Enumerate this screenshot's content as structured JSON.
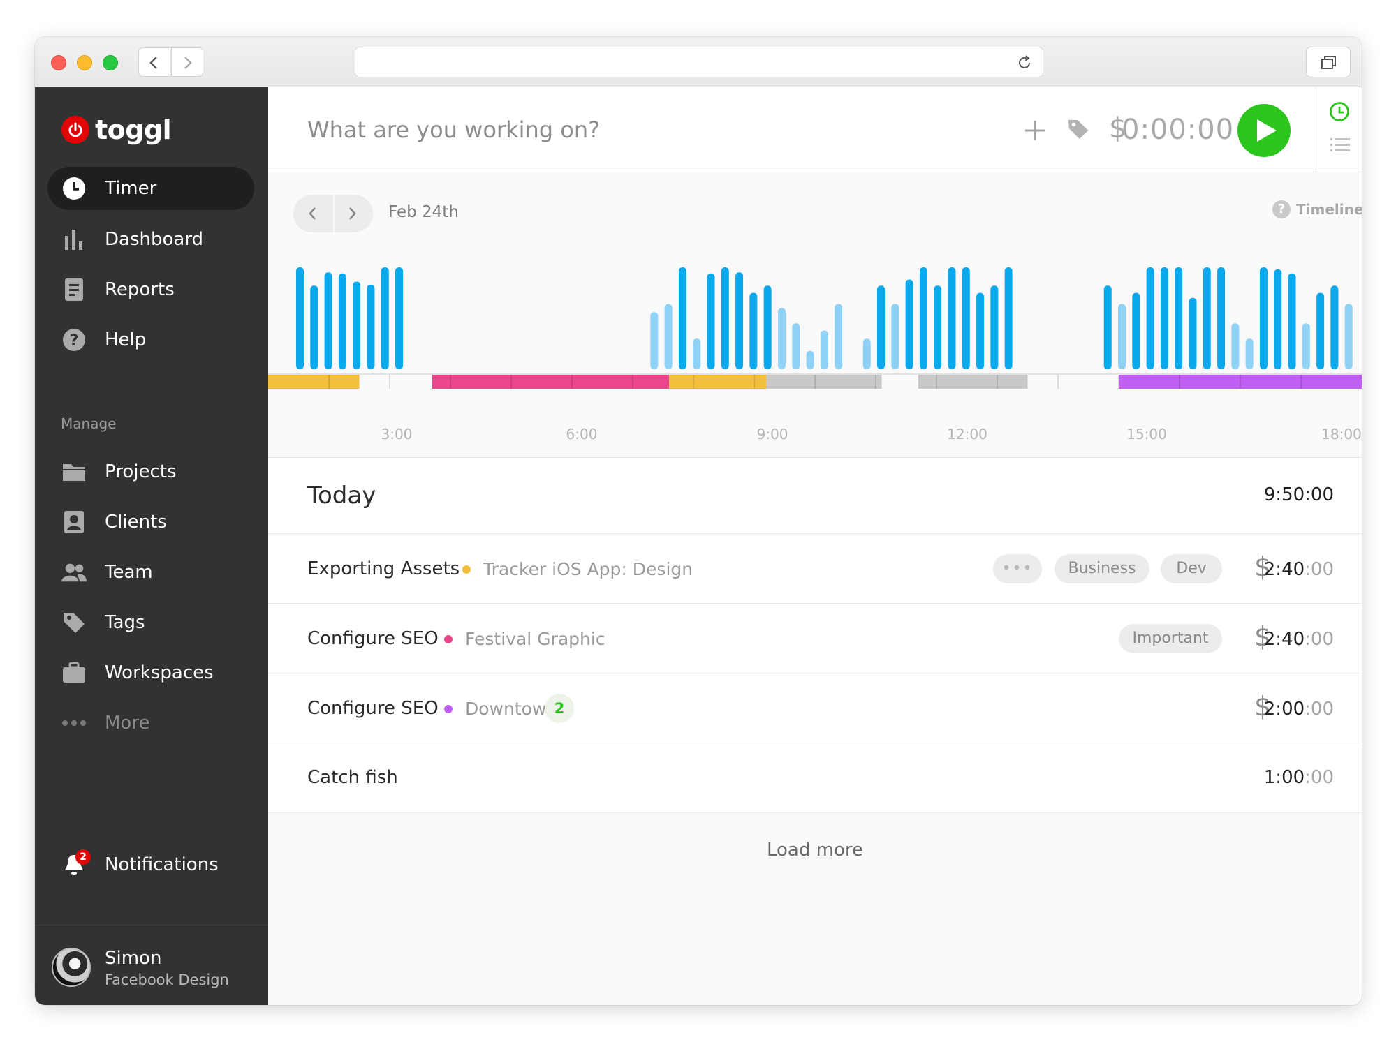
{
  "sidebar": {
    "brand": "toggl",
    "items": [
      {
        "label": "Timer"
      },
      {
        "label": "Dashboard"
      },
      {
        "label": "Reports"
      },
      {
        "label": "Help"
      }
    ],
    "section_label": "Manage",
    "manage_items": [
      {
        "label": "Projects"
      },
      {
        "label": "Clients"
      },
      {
        "label": "Team"
      },
      {
        "label": "Tags"
      },
      {
        "label": "Workspaces"
      },
      {
        "label": "More"
      }
    ],
    "notifications": {
      "label": "Notifications",
      "count": "2"
    },
    "user": {
      "name": "Simon",
      "workspace": "Facebook Design"
    }
  },
  "timer": {
    "placeholder": "What are you working on?",
    "elapsed": "0:00:00"
  },
  "timeline": {
    "date": "Feb 24th",
    "mode": "Timeline",
    "tick_labels": [
      "3:00",
      "6:00",
      "9:00",
      "12:00",
      "15:00",
      "18:00"
    ]
  },
  "chart_data": {
    "type": "bar",
    "description_unit": "activity level per time slot",
    "values": [
      1.0,
      0.82,
      0.95,
      0.94,
      0.86,
      0.83,
      1.0,
      1.0,
      null,
      null,
      null,
      null,
      null,
      null,
      null,
      null,
      null,
      null,
      null,
      null,
      null,
      null,
      null,
      null,
      null,
      0.56,
      0.64,
      1.0,
      0.3,
      0.94,
      1.0,
      0.95,
      0.75,
      0.82,
      0.6,
      0.45,
      0.18,
      0.38,
      0.64,
      null,
      0.3,
      0.82,
      0.64,
      0.88,
      1.0,
      0.82,
      1.0,
      1.0,
      0.75,
      0.82,
      1.0,
      null,
      null,
      null,
      null,
      null,
      null,
      0.82,
      0.64,
      0.75,
      1.0,
      1.0,
      1.0,
      0.7,
      1.0,
      1.0,
      0.45,
      0.3,
      1.0,
      0.98,
      0.94,
      0.45,
      0.75,
      0.82,
      0.64
    ],
    "tracked_segments": [
      {
        "from": 0.0,
        "to": 1.5,
        "color": "#f2bf3c"
      },
      {
        "from": 2.7,
        "to": 6.6,
        "color": "#e9468b"
      },
      {
        "from": 6.6,
        "to": 8.2,
        "color": "#f2bf3c"
      },
      {
        "from": 8.2,
        "to": 10.1,
        "color": "#c9c9c9"
      },
      {
        "from": 10.7,
        "to": 12.5,
        "color": "#c9c9c9"
      },
      {
        "from": 14.0,
        "to": 18.0,
        "color": "#c15ff0"
      }
    ],
    "bar_colors": {
      "strong": "#0aa8ec",
      "light": "#8fd2f5"
    }
  },
  "today": {
    "title": "Today",
    "total": "9:50:00",
    "entries": [
      {
        "description": "Exporting Assets",
        "project": "Tracker iOS App: Design",
        "project_color": "#f2bf3c",
        "tags": [
          "Business",
          "Dev"
        ],
        "more_tags": "•••",
        "billable": "$",
        "duration_main": "2:40",
        "duration_secs": ":00"
      },
      {
        "description": "Configure SEO",
        "project": "Festival Graphic",
        "project_color": "#e9468b",
        "tags": [
          "Important"
        ],
        "billable": "$",
        "duration_main": "2:40",
        "duration_secs": ":00"
      },
      {
        "description": "Configure SEO",
        "project": "Downtown",
        "project_color": "#c15ff0",
        "group_count": "2",
        "billable": "$",
        "duration_main": "2:00",
        "duration_secs": ":00"
      },
      {
        "description": "Catch fish",
        "duration_main": "1:00",
        "duration_secs": ":00"
      }
    ],
    "load_more": "Load more"
  }
}
